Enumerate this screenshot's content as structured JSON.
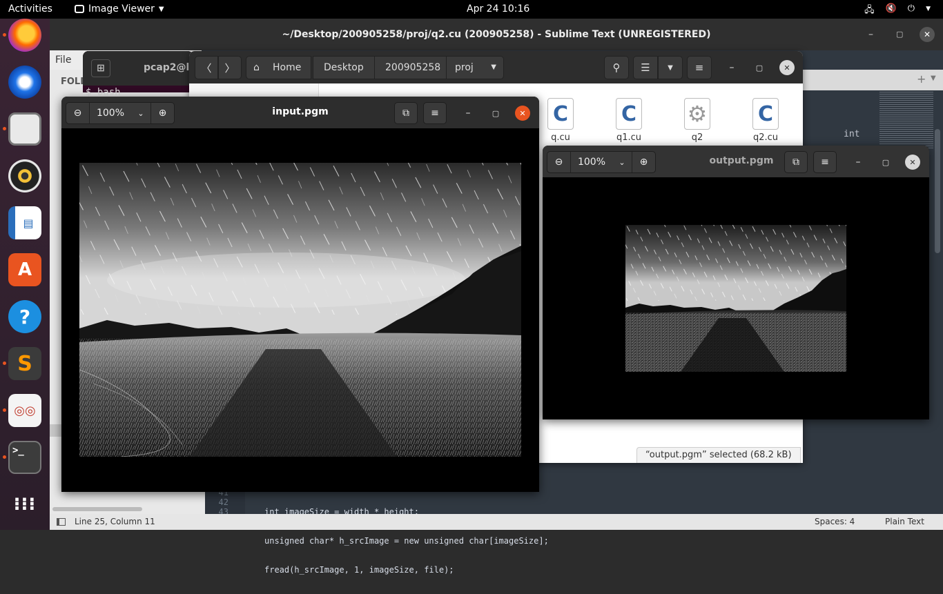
{
  "topbar": {
    "activities": "Activities",
    "app_name": "Image Viewer",
    "clock": "Apr 24  10:16"
  },
  "dock": {
    "items": [
      "firefox-icon",
      "thunderbird-icon",
      "files-icon",
      "rhythmbox-icon",
      "libreoffice-impress-icon",
      "ubuntu-software-icon",
      "help-icon",
      "sublime-text-icon",
      "document-viewer-icon",
      "terminal-icon",
      "show-apps-icon"
    ]
  },
  "sublime": {
    "title": "~/Desktop/200905258/proj/q2.cu (200905258) - Sublime Text (UNREGISTERED)",
    "menu_file": "File",
    "sidebar_folders": "FOLD",
    "minimap_word": "int",
    "gutter": [
      "41",
      "42",
      "43"
    ],
    "code": [
      "int imageSize = width * height;",
      "unsigned char* h_srcImage = new unsigned char[imageSize];",
      "fread(h_srcImage, 1, imageSize, file);"
    ],
    "status_left": "Line 25, Column 11",
    "status_spaces": "Spaces: 4",
    "status_syntax": "Plain Text"
  },
  "terminal": {
    "title": "pcap2@lp",
    "prompt": "$ bash"
  },
  "files": {
    "breadcrumbs": [
      "Home",
      "Desktop",
      "200905258",
      "proj"
    ],
    "items": [
      {
        "name": "q.cu",
        "icon": "C"
      },
      {
        "name": "q1.cu",
        "icon": "C"
      },
      {
        "name": "q2",
        "icon": "gear"
      },
      {
        "name": "q2.cu",
        "icon": "C"
      }
    ],
    "status": "“output.pgm” selected  (68.2 kB)"
  },
  "viewer_input": {
    "title": "input.pgm",
    "zoom": "100%"
  },
  "viewer_output": {
    "title": "output.pgm",
    "zoom": "100%"
  }
}
